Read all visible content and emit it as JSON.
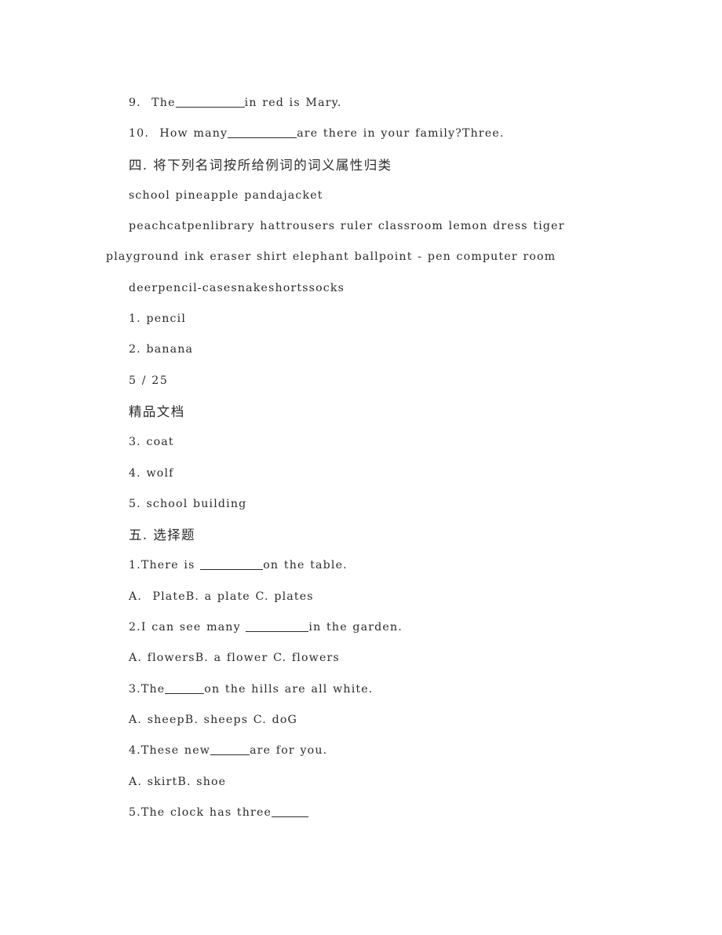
{
  "document": {
    "watermark_label": "精品文档",
    "page_marker": "5 / 25"
  },
  "fill_in_questions": [
    {
      "number": "9.",
      "before": "The",
      "after": "in red is Mary.",
      "blank": "xl"
    },
    {
      "number": "10.",
      "before": "How many",
      "after": "are there in your family?Three.",
      "blank": "xl"
    }
  ],
  "section_four": {
    "heading": "四. 将下列名词按所给例词的词义属性归类",
    "word_bank_lines": [
      "school pineapple pandajacket",
      "peachcatpenlibrary hattrousers ruler classroom lemon dress tiger",
      "playground ink eraser shirt elephant ballpoint - pen computer room",
      "deerpencil-casesnakeshortssocks"
    ],
    "answer_items": [
      "1. pencil",
      "2. banana",
      "3. coat",
      "4. wolf",
      "5. school building"
    ]
  },
  "section_five": {
    "heading": "五. 选择题",
    "questions": [
      {
        "stem_number": "1.",
        "stem_before": "There is ",
        "stem_after": "on the table.",
        "blank": "lg",
        "options": "A.  PlateB. a plate C. plates"
      },
      {
        "stem_number": "2.",
        "stem_before": "I can see many ",
        "stem_after": "in the garden.",
        "blank": "lg",
        "options": "A. flowersB. a flower C. flowers"
      },
      {
        "stem_number": "3.",
        "stem_before": "The",
        "stem_after": "on the hills are all white.",
        "blank": "md",
        "options": "A. sheepB. sheeps C. doG"
      },
      {
        "stem_number": "4.",
        "stem_before": "These new",
        "stem_after": "are for you.",
        "blank": "md",
        "options": "A. skirtB. shoe"
      },
      {
        "stem_number": "5.",
        "stem_before": "The clock has three",
        "stem_after": "",
        "blank": "sm",
        "options": ""
      }
    ]
  }
}
